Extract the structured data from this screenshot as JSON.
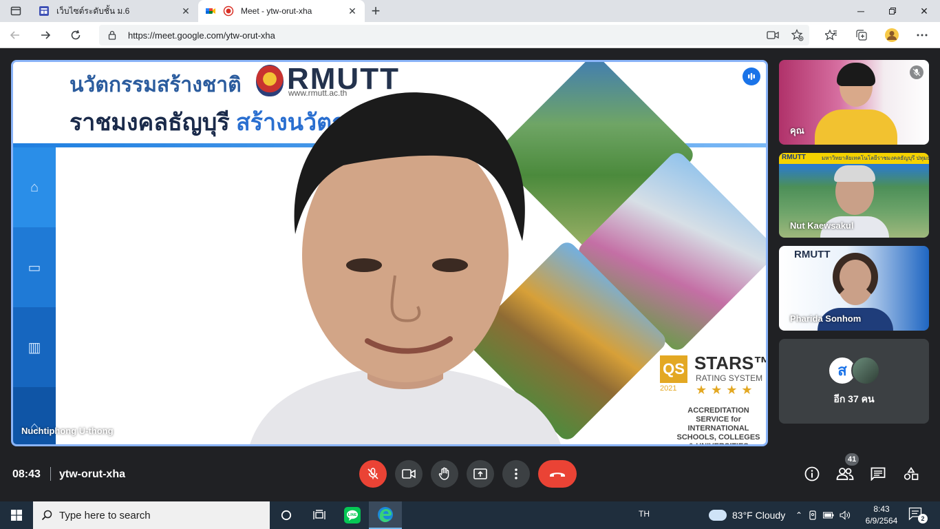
{
  "browser": {
    "tabs": [
      {
        "title": "เว็บไซต์ระดับชั้น ม.6",
        "active": false,
        "favicon": "google-sites-icon"
      },
      {
        "title": "Meet - ytw-orut-xha",
        "active": true,
        "favicon": "google-meet-icon",
        "recording": true
      }
    ],
    "new_tab_label": "+",
    "url": "https://meet.google.com/ytw-orut-xha"
  },
  "slide": {
    "line1": "นวัตกรรมสร้างชาติ",
    "line2_dark": "ราชมงคลธัญบุรี",
    "line2_blue": " สร้างนวัตกรรม",
    "logo_text": "RMUTT",
    "website": "www.rmutt.ac.th",
    "qs_box": "QS",
    "qs_title": "STARS™",
    "qs_subtitle": "RATING SYSTEM",
    "qs_year": "2021",
    "qs_rating": "★★★★",
    "accreditation": "ACCREDITATION SERVICE for INTERNATIONAL SCHOOLS, COLLEGES & UNIVERSITIES"
  },
  "main_speaker": {
    "name": "Nuchtiphong U-thong"
  },
  "participants": [
    {
      "name": "คุณ",
      "muted": true
    },
    {
      "name": "Nut Kaewsakul",
      "banner": "มหาวิทยาลัยเทคโนโลยีราชมงคลธัญบุรี ปทุมธานี",
      "logo": "RMUTT"
    },
    {
      "name": "Phari­da Sonhom",
      "logo": "RMUTT"
    }
  ],
  "more_participants": {
    "label": "อีก 37 คน",
    "avatar_letter": "ส"
  },
  "meeting": {
    "time": "08:43",
    "code": "ytw-orut-xha",
    "people_count": "41"
  },
  "taskbar": {
    "search_placeholder": "Type here to search",
    "language": "TH",
    "weather": "83°F  Cloudy",
    "clock_time": "8:43",
    "clock_date": "6/9/2564",
    "notification_count": "2"
  },
  "colors": {
    "meet_bg": "#202124",
    "accent_blue": "#8ab4f8",
    "end_call_red": "#ea4335",
    "control_gray": "#3c4043"
  }
}
